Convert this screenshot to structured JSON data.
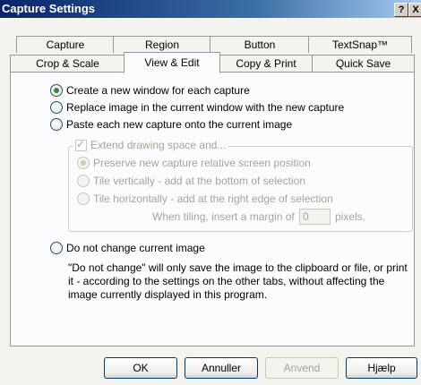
{
  "window": {
    "title": "Capture Settings",
    "help_button": "?",
    "close_button": "X"
  },
  "tabs_back_row": [
    "Capture",
    "Region",
    "Button",
    "TextSnap™"
  ],
  "tabs_front_row": [
    "Crop & Scale",
    "View & Edit",
    "Copy & Print",
    "Quick Save"
  ],
  "active_tab": "View & Edit",
  "options": {
    "new_window": "Create a new window for each capture",
    "replace_image": "Replace image in the current window with the new capture",
    "paste_capture": "Paste each new capture onto the current image",
    "extend_space": "Extend drawing space and...",
    "preserve_position": "Preserve new capture relative screen position",
    "tile_vertically": "Tile vertically - add at the bottom of selection",
    "tile_horizontally": "Tile horizontally - add at the right edge of selection",
    "margin_label": "When tiling, insert a margin of",
    "margin_value": "0",
    "margin_unit": "pixels.",
    "do_not_change": "Do not change current image",
    "note_line1": "\"Do not change\" will only save the image to the clipboard or file, or print",
    "note_line2": "it - according to the settings on the other tabs, without affecting the",
    "note_line3": "image currently displayed in this program."
  },
  "buttons": {
    "ok": "OK",
    "cancel": "Annuller",
    "apply": "Anvend",
    "help": "Hjælp"
  }
}
